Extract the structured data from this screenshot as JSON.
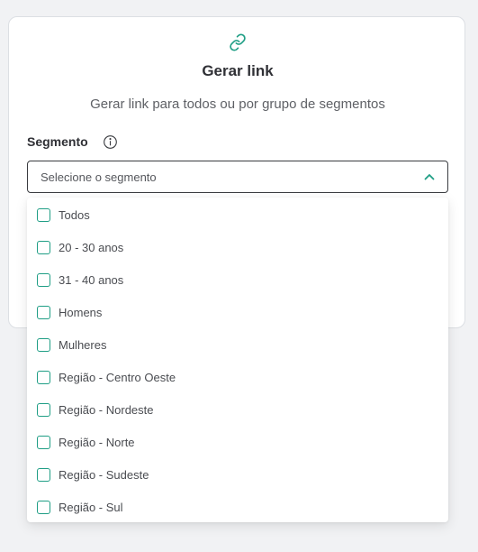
{
  "card": {
    "title": "Gerar link",
    "subtitle": "Gerar link para todos ou por grupo de segmentos",
    "icon": "link-icon",
    "accent_color": "#1f9e85"
  },
  "segment": {
    "label": "Segmento",
    "info_icon": "info-icon",
    "placeholder": "Selecione o segmento",
    "expanded": true
  },
  "options": [
    {
      "label": "Todos",
      "checked": false
    },
    {
      "label": "20 - 30 anos",
      "checked": false
    },
    {
      "label": "31 - 40 anos",
      "checked": false
    },
    {
      "label": "Homens",
      "checked": false
    },
    {
      "label": "Mulheres",
      "checked": false
    },
    {
      "label": "Região - Centro Oeste",
      "checked": false
    },
    {
      "label": "Região - Nordeste",
      "checked": false
    },
    {
      "label": "Região - Norte",
      "checked": false
    },
    {
      "label": "Região - Sudeste",
      "checked": false
    },
    {
      "label": "Região - Sul",
      "checked": false
    }
  ]
}
